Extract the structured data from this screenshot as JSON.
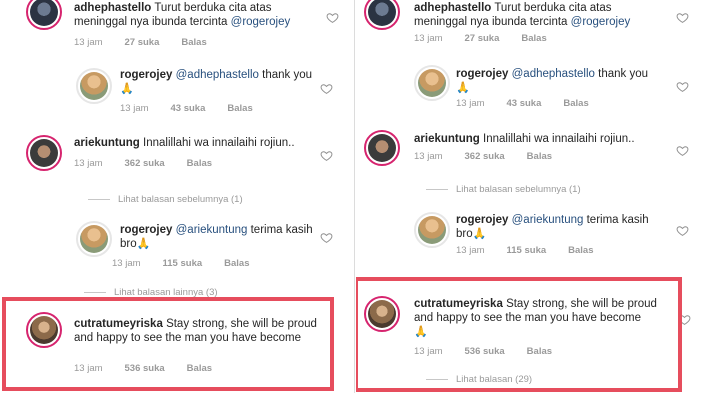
{
  "left": {
    "c1": {
      "user": "adhephastello",
      "text_a": "Turut berduka cita atas",
      "text_b": "meninggal nya ibunda tercinta",
      "mention": "@rogerojey",
      "time": "13 jam",
      "likes": "27 suka",
      "reply": "Balas"
    },
    "c2": {
      "user": "rogerojey",
      "mention": "@adhephastello",
      "text": "thank you",
      "emoji": "🙏",
      "time": "13 jam",
      "likes": "43 suka",
      "reply": "Balas"
    },
    "c3": {
      "user": "ariekuntung",
      "text": "Innalillahi wa innailaihi rojiun..",
      "time": "13 jam",
      "likes": "362 suka",
      "reply": "Balas"
    },
    "more1": "Lihat balasan sebelumnya (1)",
    "c4": {
      "user": "rogerojey",
      "mention": "@ariekuntung",
      "text": "terima kasih",
      "text_b": "bro",
      "emoji": "🙏",
      "time": "13 jam",
      "likes": "115 suka",
      "reply": "Balas"
    },
    "more2": "Lihat balasan lainnya (3)",
    "c5": {
      "user": "cutratumeyriska",
      "text_a": "Stay strong, she will be proud",
      "text_b": "and happy to see the man you have become",
      "time": "13 jam",
      "likes": "536 suka",
      "reply": "Balas"
    }
  },
  "right": {
    "c1": {
      "user": "adhephastello",
      "text_a": "Turut berduka cita atas",
      "text_b": "meninggal nya ibunda tercinta",
      "mention": "@rogerojey",
      "time": "13 jam",
      "likes": "27 suka",
      "reply": "Balas"
    },
    "c2": {
      "user": "rogerojey",
      "mention": "@adhephastello",
      "text": "thank you",
      "emoji": "🙏",
      "time": "13 jam",
      "likes": "43 suka",
      "reply": "Balas"
    },
    "c3": {
      "user": "ariekuntung",
      "text": "Innalillahi wa innailaihi rojiun..",
      "time": "13 jam",
      "likes": "362 suka",
      "reply": "Balas"
    },
    "more1": "Lihat balasan sebelumnya (1)",
    "c4": {
      "user": "rogerojey",
      "mention": "@ariekuntung",
      "text": "terima kasih",
      "text_b": "bro",
      "emoji": "🙏",
      "time": "13 jam",
      "likes": "115 suka",
      "reply": "Balas"
    },
    "c5": {
      "user": "cutratumeyriska",
      "text_a": "Stay strong, she will be proud",
      "text_b": "and happy to see the man you have become",
      "emoji": "🙏",
      "time": "13 jam",
      "likes": "536 suka",
      "reply": "Balas"
    },
    "more2": "Lihat balasan (29)"
  },
  "colors": {
    "highlight": "#e64d5d",
    "mention": "#28507e",
    "meta": "#9a9a9a",
    "story_ring": "#d6246e"
  }
}
